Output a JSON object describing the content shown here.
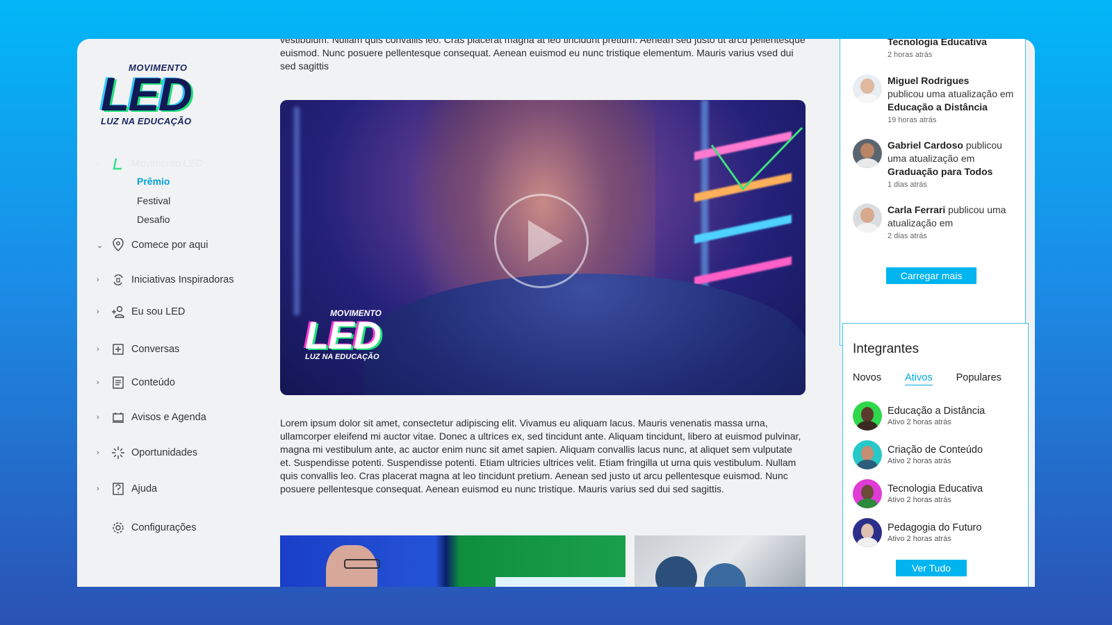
{
  "logo": {
    "top_text": "MOVIMENTO",
    "main_text": "LED",
    "bottom_text": "LUZ NA EDUCAÇÃO"
  },
  "sidebar": {
    "section": {
      "label": "Movimento LED",
      "icon": "led-logo-icon"
    },
    "subitems": [
      {
        "label": "Prêmio",
        "active": true
      },
      {
        "label": "Festival"
      },
      {
        "label": "Desafio"
      }
    ],
    "items": [
      {
        "label": "Comece por aqui",
        "icon": "map-pin-icon",
        "chevron": "down"
      },
      {
        "label": "Iniciativas Inspiradoras",
        "icon": "cycle-icon",
        "chevron": "right"
      },
      {
        "label": "Eu sou LED",
        "icon": "add-user-icon",
        "chevron": "right"
      },
      {
        "label": "Conversas",
        "icon": "plus-box-icon",
        "chevron": "right"
      },
      {
        "label": "Conteúdo",
        "icon": "document-icon",
        "chevron": "right"
      },
      {
        "label": "Avisos e Agenda",
        "icon": "calendar-icon",
        "chevron": "right"
      },
      {
        "label": "Oportunidades",
        "icon": "spark-icon",
        "chevron": "right"
      },
      {
        "label": "Ajuda",
        "icon": "help-icon",
        "chevron": "right"
      },
      {
        "label": "Configurações",
        "icon": "gear-icon",
        "chevron": ""
      }
    ]
  },
  "main": {
    "top_paragraph": "vestibulum. Nullam quis convallis leo. Cras placerat magna at leo tincidunt pretium. Aenean sed justo ut arcu pellentesque euismod. Nunc posuere pellentesque consequat. Aenean euismod eu nunc tristique elementum. Mauris varius vsed dui sed sagittis",
    "video": {
      "logo_top": "MOVIMENTO",
      "logo_main": "LED",
      "logo_bottom": "LUZ NA EDUCAÇÃO"
    },
    "body_paragraph": "Lorem ipsum dolor sit amet, consectetur adipiscing elit. Vivamus eu aliquam lacus. Mauris venenatis massa urna, ullamcorper eleifend mi auctor vitae. Donec a ultrices ex, sed tincidunt ante. Aliquam tincidunt, libero at euismod pulvinar, magna mi vestibulum ante, ac auctor enim nunc sit amet sapien. Aliquam convallis lacus nunc, at aliquet sem vulputate et. Suspendisse potenti. Suspendisse potenti. Etiam ultricies ultrices velit. Etiam fringilla ut urna quis vestibulum. Nullam quis convallis leo. Cras placerat magna at leo tincidunt pretium. Aenean sed justo ut arcu pellentesque euismod. Nunc posuere pellentesque consequat. Aenean euismod eu nunc tristique. Mauris varius sed dui sed sagittis."
  },
  "feed": {
    "items": [
      {
        "text_pre": "",
        "place": "Tecnologia Educativa",
        "time": "2 horas atrás"
      },
      {
        "name": "Miguel Rodrigues",
        "action": "publicou uma atualização em",
        "place": "Educação a Distância",
        "time": "19 horas atrás"
      },
      {
        "name": "Gabriel Cardoso",
        "action": "publicou uma atualização em",
        "place": "Graduação para Todos",
        "time": "1 dias atrás"
      },
      {
        "name": "Carla Ferrari",
        "action": "publicou uma atualização em",
        "place": "",
        "time": "2 dias atrás"
      }
    ],
    "load_more": "Carregar mais"
  },
  "members": {
    "title": "Integrantes",
    "tabs": [
      "Novos",
      "Ativos",
      "Populares"
    ],
    "active_tab": "Ativos",
    "list": [
      {
        "name": "Educação a Distância",
        "status": "Ativo 2 horas atrás",
        "color": "#2fd84a"
      },
      {
        "name": "Criação de Conteúdo",
        "status": "Ativo 2 horas atrás",
        "color": "#27c9c8"
      },
      {
        "name": "Tecnologia Educativa",
        "status": "Ativo 2 horas atrás",
        "color": "#e03bd6"
      },
      {
        "name": "Pedagogia do Futuro",
        "status": "Ativo 2 horas atrás",
        "color": "#2c2f8a"
      }
    ],
    "see_all": "Ver Tudo"
  },
  "colors": {
    "accent": "#00b4f0",
    "panel_border": "#3ec1e6",
    "active_link": "#00a3d6"
  }
}
